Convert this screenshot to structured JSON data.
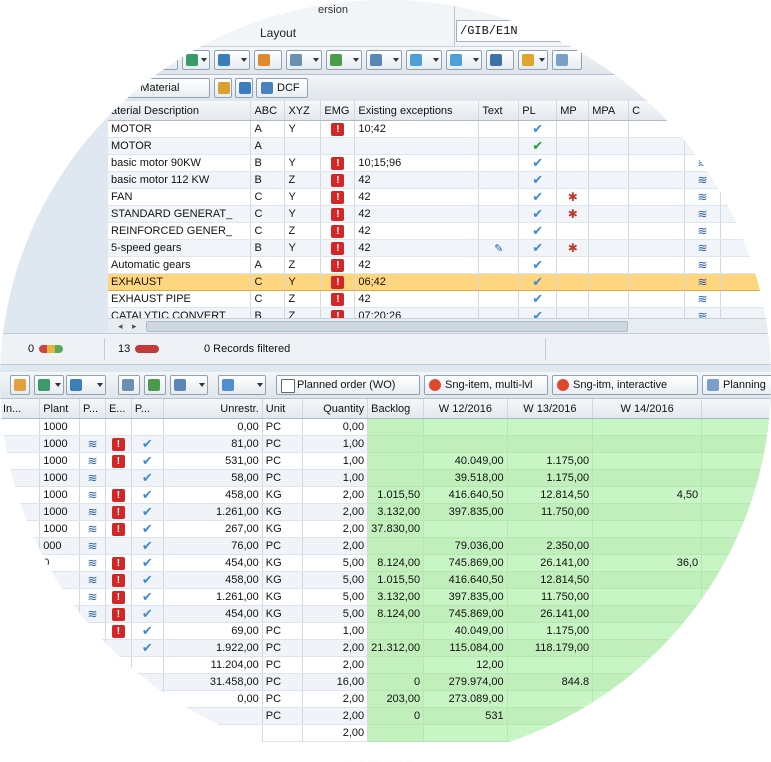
{
  "header": {
    "version_text": "ersion",
    "layout_label": "Layout",
    "layout_value": "/GIB/E1N"
  },
  "toolbar1": {
    "buttons": [
      "tb-icon-1",
      "tb-icon-2",
      "tb-icon-3",
      "tb-icon-4",
      "tb-icon-5",
      "tb-icon-6",
      "tb-icon-7",
      "tb-icon-8",
      "tb-icon-9",
      "tb-icon-10",
      "tb-icon-11",
      "tb-icon-12"
    ]
  },
  "toolbar2": {
    "change_material": "ge Material",
    "dcf": "DCF"
  },
  "materials": {
    "columns": [
      "aterial Description",
      "ABC",
      "XYZ",
      "EMG",
      "Existing exceptions",
      "Text",
      "PL",
      "MP",
      "MPA",
      "C"
    ],
    "rows": [
      {
        "desc": "MOTOR",
        "abc": "A",
        "xyz": "Y",
        "emg": true,
        "exc": "10;42",
        "text": false,
        "pl": "blue",
        "mp": false,
        "ov": false
      },
      {
        "desc": "MOTOR",
        "abc": "A",
        "xyz": "",
        "emg": false,
        "exc": "",
        "text": false,
        "pl": "green",
        "mp": false,
        "ov": false
      },
      {
        "desc": "basic motor 90KW",
        "abc": "B",
        "xyz": "Y",
        "emg": true,
        "exc": "10;15;96",
        "text": false,
        "pl": "blue",
        "mp": false,
        "ov": true
      },
      {
        "desc": "basic motor 112 KW",
        "abc": "B",
        "xyz": "Z",
        "emg": true,
        "exc": "42",
        "text": false,
        "pl": "blue",
        "mp": false,
        "ov": true
      },
      {
        "desc": "FAN",
        "abc": "C",
        "xyz": "Y",
        "emg": true,
        "exc": "42",
        "text": false,
        "pl": "blue",
        "mp": true,
        "ov": true
      },
      {
        "desc": "STANDARD GENERAT_",
        "abc": "C",
        "xyz": "Y",
        "emg": true,
        "exc": "42",
        "text": false,
        "pl": "blue",
        "mp": true,
        "ov": true
      },
      {
        "desc": "REINFORCED GENER_",
        "abc": "C",
        "xyz": "Z",
        "emg": true,
        "exc": "42",
        "text": false,
        "pl": "blue",
        "mp": false,
        "ov": true
      },
      {
        "desc": "5-speed gears",
        "abc": "B",
        "xyz": "Y",
        "emg": true,
        "exc": "42",
        "text": true,
        "pl": "blue",
        "mp": true,
        "ov": true
      },
      {
        "desc": "Automatic gears",
        "abc": "A",
        "xyz": "Z",
        "emg": true,
        "exc": "42",
        "text": false,
        "pl": "blue",
        "mp": false,
        "ov": true
      },
      {
        "desc": "EXHAUST",
        "abc": "C",
        "xyz": "Y",
        "emg": true,
        "exc": "06;42",
        "text": false,
        "pl": "blue",
        "mp": false,
        "ov": true,
        "selected": true
      },
      {
        "desc": "EXHAUST PIPE",
        "abc": "C",
        "xyz": "Z",
        "emg": true,
        "exc": "42",
        "text": false,
        "pl": "blue",
        "mp": false,
        "ov": true
      },
      {
        "desc": "CATALYTIC CONVERT",
        "abc": "B",
        "xyz": "Z",
        "emg": true,
        "exc": "07;20;26",
        "text": false,
        "pl": "blue",
        "mp": false,
        "ov": true
      }
    ]
  },
  "status": {
    "count_a": "0",
    "count_b": "13",
    "filtered": "0 Records filtered"
  },
  "toolbar3": {
    "planned_order": "Planned order (WO)",
    "sng_multi": "Sng-item, multi-lvl",
    "sng_interactive": "Sng-itm, interactive",
    "planning": "Planning"
  },
  "stock": {
    "columns": [
      "In...",
      "Plant",
      "P...",
      "E...",
      "P...",
      "Unrestr.",
      "Unit",
      "Quantity",
      "Backlog",
      "W 12/2016",
      "W 13/2016",
      "W 14/2016"
    ],
    "rows": [
      {
        "plant": "1000",
        "ov": false,
        "emg": false,
        "pl": false,
        "unrestr": "0,00",
        "unit": "PC",
        "qty": "0,00",
        "backlog": "",
        "w12": "",
        "w13": "",
        "w14": ""
      },
      {
        "plant": "1000",
        "ov": true,
        "emg": true,
        "pl": true,
        "unrestr": "81,00",
        "unit": "PC",
        "qty": "1,00",
        "backlog": "",
        "w12": "",
        "w13": "",
        "w14": ""
      },
      {
        "plant": "1000",
        "ov": true,
        "emg": true,
        "pl": true,
        "unrestr": "531,00",
        "unit": "PC",
        "qty": "1,00",
        "backlog": "",
        "w12": "40.049,00",
        "w13": "1.175,00",
        "w14": ""
      },
      {
        "plant": "1000",
        "ov": true,
        "emg": false,
        "pl": true,
        "unrestr": "58,00",
        "unit": "PC",
        "qty": "1,00",
        "backlog": "",
        "w12": "39.518,00",
        "w13": "1.175,00",
        "w14": ""
      },
      {
        "plant": "1000",
        "ov": true,
        "emg": true,
        "pl": true,
        "unrestr": "458,00",
        "unit": "KG",
        "qty": "2,00",
        "backlog": "1.015,50",
        "w12": "416.640,50",
        "w13": "12.814,50",
        "w14": "4,50"
      },
      {
        "plant": "1000",
        "ov": true,
        "emg": true,
        "pl": true,
        "unrestr": "1.261,00",
        "unit": "KG",
        "qty": "2,00",
        "backlog": "3.132,00",
        "w12": "397.835,00",
        "w13": "11.750,00",
        "w14": ""
      },
      {
        "plant": "1000",
        "ov": true,
        "emg": true,
        "pl": true,
        "unrestr": "267,00",
        "unit": "KG",
        "qty": "2,00",
        "backlog": "37.830,00",
        "w12": "",
        "w13": "",
        "w14": ""
      },
      {
        "plant": "000",
        "ov": true,
        "emg": false,
        "pl": true,
        "unrestr": "76,00",
        "unit": "PC",
        "qty": "2,00",
        "backlog": "",
        "w12": "79.036,00",
        "w13": "2.350,00",
        "w14": ""
      },
      {
        "plant": "0",
        "ov": true,
        "emg": true,
        "pl": true,
        "unrestr": "454,00",
        "unit": "KG",
        "qty": "5,00",
        "backlog": "8.124,00",
        "w12": "745.869,00",
        "w13": "26.141,00",
        "w14": "36,0"
      },
      {
        "plant": "",
        "ov": true,
        "emg": true,
        "pl": true,
        "unrestr": "458,00",
        "unit": "KG",
        "qty": "5,00",
        "backlog": "1.015,50",
        "w12": "416.640,50",
        "w13": "12.814,50",
        "w14": ""
      },
      {
        "plant": "",
        "ov": true,
        "emg": true,
        "pl": true,
        "unrestr": "1.261,00",
        "unit": "KG",
        "qty": "5,00",
        "backlog": "3.132,00",
        "w12": "397.835,00",
        "w13": "11.750,00",
        "w14": ""
      },
      {
        "plant": "",
        "ov": true,
        "emg": true,
        "pl": true,
        "unrestr": "454,00",
        "unit": "KG",
        "qty": "5,00",
        "backlog": "8.124,00",
        "w12": "745.869,00",
        "w13": "26.141,00",
        "w14": ""
      },
      {
        "plant": "",
        "ov": false,
        "emg": true,
        "pl": true,
        "unrestr": "69,00",
        "unit": "PC",
        "qty": "1,00",
        "backlog": "",
        "w12": "40.049,00",
        "w13": "1.175,00",
        "w14": ""
      },
      {
        "plant": "",
        "ov": false,
        "emg": false,
        "pl": true,
        "unrestr": "1.922,00",
        "unit": "PC",
        "qty": "2,00",
        "backlog": "21.312,00",
        "w12": "115.084,00",
        "w13": "118.179,00",
        "w14": ""
      },
      {
        "plant": "",
        "ov": false,
        "emg": false,
        "pl": false,
        "unrestr": "11.204,00",
        "unit": "PC",
        "qty": "2,00",
        "backlog": "",
        "w12": "12,00",
        "w13": "",
        "w14": ""
      },
      {
        "plant": "",
        "ov": false,
        "emg": false,
        "pl": false,
        "unrestr": "31.458,00",
        "unit": "PC",
        "qty": "16,00",
        "backlog": "0",
        "w12": "279.974,00",
        "w13": "844.8",
        "w14": ""
      },
      {
        "plant": "",
        "ov": false,
        "emg": false,
        "pl": false,
        "unrestr": "0,00",
        "unit": "PC",
        "qty": "2,00",
        "backlog": "203,00",
        "w12": "273.089,00",
        "w13": "",
        "w14": ""
      },
      {
        "plant": "",
        "ov": false,
        "emg": false,
        "pl": false,
        "unrestr": "",
        "unit": "PC",
        "qty": "2,00",
        "backlog": "0",
        "w12": "531",
        "w13": "",
        "w14": ""
      },
      {
        "plant": "",
        "ov": false,
        "emg": false,
        "pl": false,
        "unrestr": "",
        "unit": "",
        "qty": "2,00",
        "backlog": "",
        "w12": "",
        "w13": "",
        "w14": ""
      }
    ]
  },
  "colors": {
    "selected_row": "#ffd680",
    "green_cell": "#c8f5c4",
    "emg_red": "#d32626",
    "pl_blue": "#3c8bd4"
  }
}
